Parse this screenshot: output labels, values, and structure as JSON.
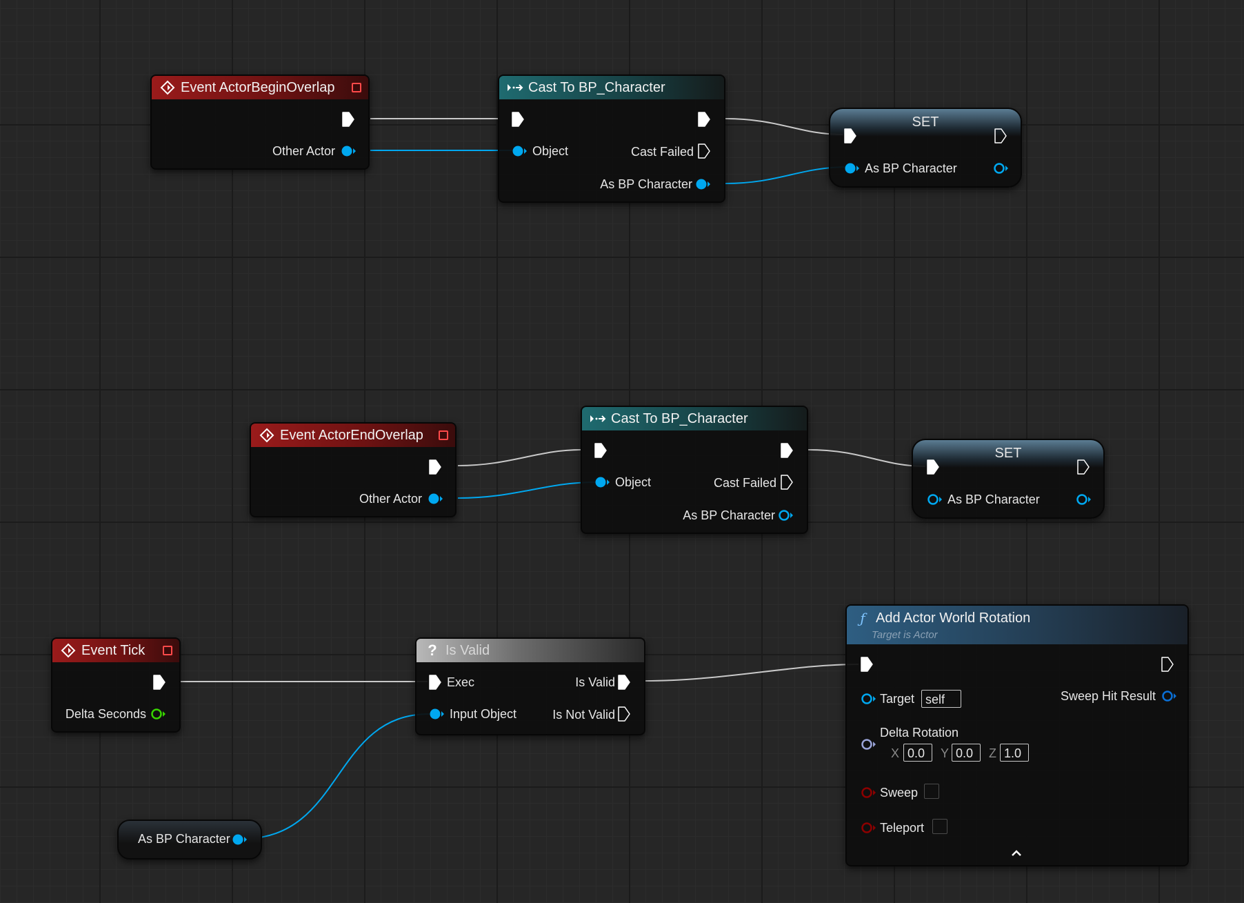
{
  "graph": {
    "event_begin_overlap": {
      "title": "Event ActorBeginOverlap",
      "pin_other_actor": "Other Actor"
    },
    "cast_1": {
      "title": "Cast To BP_Character",
      "pin_object": "Object",
      "pin_cast_failed": "Cast Failed",
      "pin_as_bp_character": "As BP Character"
    },
    "set_1": {
      "title": "SET",
      "pin_as_bp_character": "As BP Character"
    },
    "event_end_overlap": {
      "title": "Event ActorEndOverlap",
      "pin_other_actor": "Other Actor"
    },
    "cast_2": {
      "title": "Cast To BP_Character",
      "pin_object": "Object",
      "pin_cast_failed": "Cast Failed",
      "pin_as_bp_character": "As BP Character"
    },
    "set_2": {
      "title": "SET",
      "pin_as_bp_character": "As BP Character"
    },
    "event_tick": {
      "title": "Event Tick",
      "pin_delta_seconds": "Delta Seconds"
    },
    "is_valid": {
      "title": "Is Valid",
      "pin_exec": "Exec",
      "pin_input_object": "Input Object",
      "pin_is_valid": "Is Valid",
      "pin_is_not_valid": "Is Not Valid"
    },
    "get_var": {
      "label": "As BP Character"
    },
    "add_rotation": {
      "title": "Add Actor World Rotation",
      "subtitle": "Target is Actor",
      "pin_target": "Target",
      "target_value": "self",
      "pin_delta_rotation": "Delta Rotation",
      "rot_x_label": "X",
      "rot_x": "0.0",
      "rot_y_label": "Y",
      "rot_y": "0.0",
      "rot_z_label": "Z",
      "rot_z": "1.0",
      "pin_sweep": "Sweep",
      "pin_teleport": "Teleport",
      "pin_sweep_hit_result": "Sweep Hit Result"
    }
  },
  "colors": {
    "object_pin": "#00a8f0",
    "float_pin": "#38d400",
    "rotator_pin": "#9aa4d8",
    "bool_pin": "#8c0000",
    "exec_pin": "#ffffff",
    "event_header": "#9a1b1b",
    "cast_header": "#1f6b70",
    "function_header": "#2e5e82"
  }
}
